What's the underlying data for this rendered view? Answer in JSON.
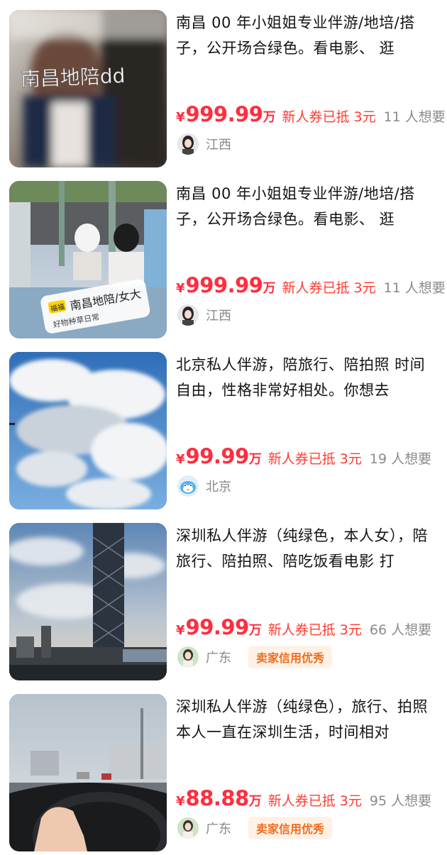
{
  "listings": [
    {
      "title": "南昌 00 年小姐姐专业伴游/地培/搭子，公开场合绿色。看电影、 逛",
      "currency": "¥",
      "price": "999.99",
      "unit": "万",
      "coupon": "新人券已抵 3元",
      "want": "11 人想要",
      "region": "江西",
      "badge": "",
      "image_overlay": "南昌地陪dd",
      "image_sticker_title": "",
      "image_sticker_sub": "",
      "image_sticker_tag": ""
    },
    {
      "title": "南昌 00 年小姐姐专业伴游/地培/搭子，公开场合绿色。看电影、 逛",
      "currency": "¥",
      "price": "999.99",
      "unit": "万",
      "coupon": "新人券已抵 3元",
      "want": "11 人想要",
      "region": "江西",
      "badge": "",
      "image_overlay": "",
      "image_sticker_title": "南昌地陪/女大",
      "image_sticker_sub": "好物种草日常",
      "image_sticker_tag": "福福"
    },
    {
      "title": "北京私人伴游，陪旅行、陪拍照 时间自由，性格非常好相处。你想去",
      "currency": "¥",
      "price": "99.99",
      "unit": "万",
      "coupon": "新人券已抵 3元",
      "want": "19 人想要",
      "region": "北京",
      "badge": "",
      "image_overlay": "",
      "image_sticker_title": "",
      "image_sticker_sub": "",
      "image_sticker_tag": ""
    },
    {
      "title": "深圳私人伴游（纯绿色，本人女），陪旅行、陪拍照、陪吃饭看电影 打",
      "currency": "¥",
      "price": "99.99",
      "unit": "万",
      "coupon": "新人券已抵 3元",
      "want": "66 人想要",
      "region": "广东",
      "badge": "卖家信用优秀",
      "image_overlay": "",
      "image_sticker_title": "",
      "image_sticker_sub": "",
      "image_sticker_tag": ""
    },
    {
      "title": "深圳私人伴游（纯绿色），旅行、拍照 本人一直在深圳生活，时间相对",
      "currency": "¥",
      "price": "88.88",
      "unit": "万",
      "coupon": "新人券已抵 3元",
      "want": "95 人想要",
      "region": "广东",
      "badge": "卖家信用优秀",
      "image_overlay": "",
      "image_sticker_title": "",
      "image_sticker_sub": "",
      "image_sticker_tag": ""
    }
  ],
  "colors": {
    "price": "#ff2d3f",
    "coupon": "#ff3b30",
    "muted": "#8b8b8b",
    "badge_text": "#ef6d1c",
    "badge_bg": "#fff1e6"
  }
}
